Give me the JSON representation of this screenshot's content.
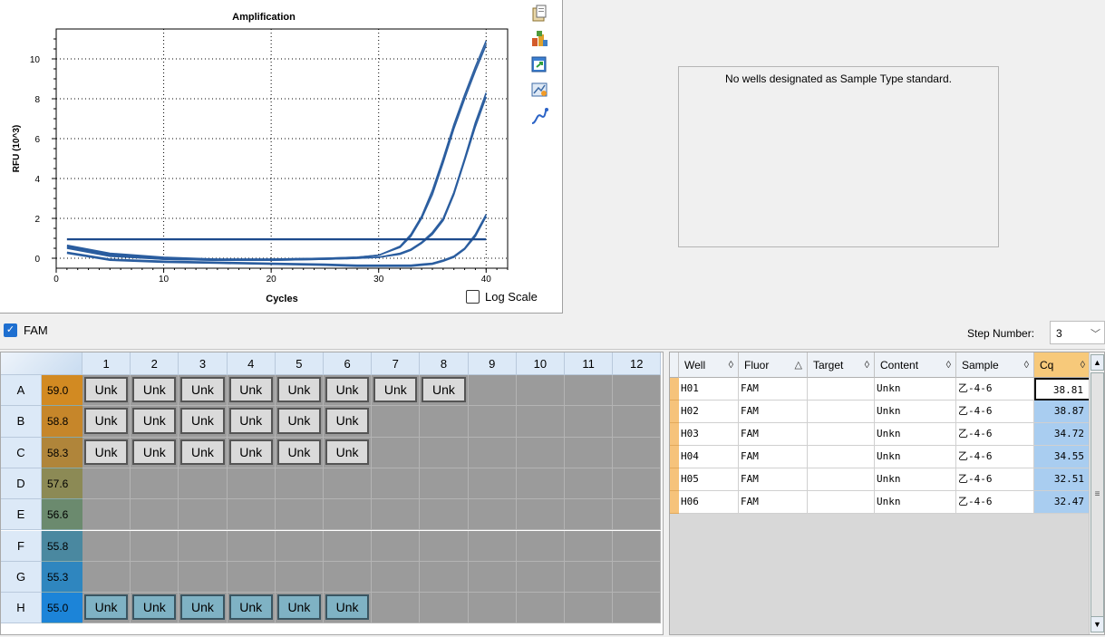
{
  "chart": {
    "title": "Amplification",
    "xlabel": "Cycles",
    "ylabel": "RFU (10^3)",
    "log_scale_label": "Log Scale",
    "log_scale_checked": false
  },
  "chart_data": {
    "type": "line",
    "title": "Amplification",
    "xlabel": "Cycles",
    "ylabel": "RFU (10^3)",
    "xlim": [
      0,
      42
    ],
    "ylim": [
      -0.5,
      11.5
    ],
    "x_ticks": [
      0,
      10,
      20,
      30,
      40
    ],
    "y_ticks": [
      0,
      2,
      4,
      6,
      8,
      10
    ],
    "grid": true,
    "threshold": 0.95,
    "series": [
      {
        "x": [
          1,
          5,
          10,
          15,
          20,
          25,
          28,
          30,
          32,
          33,
          34,
          35,
          36,
          37,
          38,
          39,
          40
        ],
        "y": [
          0.6,
          0.2,
          0.0,
          -0.05,
          -0.05,
          0.0,
          0.05,
          0.15,
          0.6,
          1.2,
          2.1,
          3.4,
          5.0,
          6.7,
          8.2,
          9.6,
          10.9
        ]
      },
      {
        "x": [
          1,
          5,
          10,
          15,
          20,
          25,
          28,
          30,
          32,
          33,
          34,
          35,
          36,
          37,
          38,
          39,
          40
        ],
        "y": [
          0.65,
          0.25,
          0.05,
          -0.05,
          -0.05,
          0.0,
          0.05,
          0.15,
          0.55,
          1.1,
          2.0,
          3.2,
          4.8,
          6.5,
          8.0,
          9.4,
          10.7
        ]
      },
      {
        "x": [
          1,
          5,
          10,
          15,
          20,
          25,
          28,
          30,
          32,
          33,
          34,
          35,
          36,
          37,
          38,
          39,
          40
        ],
        "y": [
          0.55,
          0.15,
          -0.05,
          -0.1,
          -0.1,
          -0.05,
          0.0,
          0.05,
          0.25,
          0.45,
          0.8,
          1.3,
          2.0,
          3.3,
          5.0,
          6.8,
          8.3
        ]
      },
      {
        "x": [
          1,
          5,
          10,
          15,
          20,
          25,
          28,
          30,
          32,
          33,
          34,
          35,
          36,
          37,
          38,
          39,
          40
        ],
        "y": [
          0.5,
          0.1,
          -0.05,
          -0.1,
          -0.1,
          -0.05,
          0.0,
          0.05,
          0.2,
          0.4,
          0.75,
          1.2,
          1.9,
          3.2,
          4.9,
          6.6,
          8.1
        ]
      },
      {
        "x": [
          1,
          5,
          10,
          15,
          20,
          25,
          28,
          30,
          32,
          33,
          34,
          35,
          36,
          37,
          38,
          39,
          40
        ],
        "y": [
          0.3,
          -0.05,
          -0.15,
          -0.2,
          -0.25,
          -0.3,
          -0.35,
          -0.35,
          -0.35,
          -0.35,
          -0.3,
          -0.25,
          -0.1,
          0.1,
          0.5,
          1.2,
          2.2
        ]
      },
      {
        "x": [
          1,
          5,
          10,
          15,
          20,
          25,
          28,
          30,
          32,
          33,
          34,
          35,
          36,
          37,
          38,
          39,
          40
        ],
        "y": [
          0.25,
          -0.1,
          -0.2,
          -0.25,
          -0.3,
          -0.35,
          -0.4,
          -0.4,
          -0.4,
          -0.4,
          -0.35,
          -0.3,
          -0.15,
          0.05,
          0.45,
          1.1,
          2.1
        ]
      }
    ]
  },
  "toolbar_icons": [
    "copy-icon",
    "data-export-icon",
    "export-icon",
    "chart-settings-icon",
    "curve-icon"
  ],
  "standard_curve": {
    "message": "No wells designated as Sample Type standard."
  },
  "fluor_bar": {
    "label": "FAM",
    "checked": true,
    "step_label": "Step Number:",
    "step_value": "3"
  },
  "plate": {
    "columns": [
      "1",
      "2",
      "3",
      "4",
      "5",
      "6",
      "7",
      "8",
      "9",
      "10",
      "11",
      "12"
    ],
    "rows": [
      {
        "label": "A",
        "temp": "59.0",
        "temp_color": "#d28a22",
        "wells": [
          "Unk",
          "Unk",
          "Unk",
          "Unk",
          "Unk",
          "Unk",
          "Unk",
          "Unk",
          "",
          "",
          "",
          ""
        ],
        "selected": false
      },
      {
        "label": "B",
        "temp": "58.8",
        "temp_color": "#c6862a",
        "wells": [
          "Unk",
          "Unk",
          "Unk",
          "Unk",
          "Unk",
          "Unk",
          "",
          "",
          "",
          "",
          "",
          ""
        ],
        "selected": false
      },
      {
        "label": "C",
        "temp": "58.3",
        "temp_color": "#b0853a",
        "wells": [
          "Unk",
          "Unk",
          "Unk",
          "Unk",
          "Unk",
          "Unk",
          "",
          "",
          "",
          "",
          "",
          ""
        ],
        "selected": false
      },
      {
        "label": "D",
        "temp": "57.6",
        "temp_color": "#8c8a55",
        "wells": [
          "",
          "",
          "",
          "",
          "",
          "",
          "",
          "",
          "",
          "",
          "",
          ""
        ],
        "selected": false
      },
      {
        "label": "E",
        "temp": "56.6",
        "temp_color": "#6b8a6e",
        "wells": [
          "",
          "",
          "",
          "",
          "",
          "",
          "",
          "",
          "",
          "",
          "",
          ""
        ],
        "selected": false
      },
      {
        "label": "F",
        "temp": "55.8",
        "temp_color": "#4a88a0",
        "wells": [
          "",
          "",
          "",
          "",
          "",
          "",
          "",
          "",
          "",
          "",
          "",
          ""
        ],
        "selected": false
      },
      {
        "label": "G",
        "temp": "55.3",
        "temp_color": "#2f86bf",
        "wells": [
          "",
          "",
          "",
          "",
          "",
          "",
          "",
          "",
          "",
          "",
          "",
          ""
        ],
        "selected": false
      },
      {
        "label": "H",
        "temp": "55.0",
        "temp_color": "#1c84d8",
        "wells": [
          "Unk",
          "Unk",
          "Unk",
          "Unk",
          "Unk",
          "Unk",
          "",
          "",
          "",
          "",
          "",
          ""
        ],
        "selected": true
      }
    ]
  },
  "results": {
    "headers": {
      "well": "Well",
      "fluor": "Fluor",
      "target": "Target",
      "content": "Content",
      "sample": "Sample",
      "cq": "Cq"
    },
    "sort_icons": {
      "well": "◊",
      "fluor": "△",
      "target": "◊",
      "content": "◊",
      "sample": "◊",
      "cq": "◊"
    },
    "rows": [
      {
        "well": "H01",
        "fluor": "FAM",
        "target": "",
        "content": "Unkn",
        "sample": "乙-4-6",
        "cq": "38.81"
      },
      {
        "well": "H02",
        "fluor": "FAM",
        "target": "",
        "content": "Unkn",
        "sample": "乙-4-6",
        "cq": "38.87"
      },
      {
        "well": "H03",
        "fluor": "FAM",
        "target": "",
        "content": "Unkn",
        "sample": "乙-4-6",
        "cq": "34.72"
      },
      {
        "well": "H04",
        "fluor": "FAM",
        "target": "",
        "content": "Unkn",
        "sample": "乙-4-6",
        "cq": "34.55"
      },
      {
        "well": "H05",
        "fluor": "FAM",
        "target": "",
        "content": "Unkn",
        "sample": "乙-4-6",
        "cq": "32.51"
      },
      {
        "well": "H06",
        "fluor": "FAM",
        "target": "",
        "content": "Unkn",
        "sample": "乙-4-6",
        "cq": "32.47"
      }
    ]
  }
}
